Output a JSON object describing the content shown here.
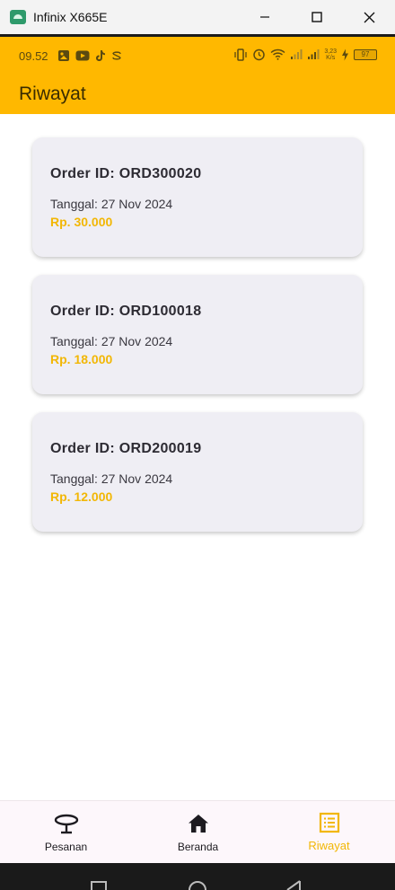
{
  "window": {
    "title": "Infinix X665E",
    "controls": [
      "minimize-icon",
      "maximize-icon",
      "close-icon"
    ]
  },
  "status_bar": {
    "time": "09.52",
    "network_speed_value": "3,23",
    "network_speed_unit": "K/s",
    "battery": "97",
    "icons_left": [
      "gallery-icon",
      "youtube-icon",
      "tiktok-icon",
      "cloud-sync-icon"
    ],
    "icons_right": [
      "vibrate-icon",
      "alarm-icon",
      "wifi-icon",
      "signal-icon",
      "signal-icon",
      "charging-icon",
      "battery-icon"
    ]
  },
  "app_bar": {
    "title": "Riwayat",
    "color": "#ffb800"
  },
  "orders": [
    {
      "order_id": "Order ID: ORD300020",
      "date": "Tanggal: 27 Nov 2024",
      "total": "Rp. 30.000"
    },
    {
      "order_id": "Order ID: ORD100018",
      "date": "Tanggal: 27 Nov 2024",
      "total": "Rp. 18.000"
    },
    {
      "order_id": "Order ID: ORD200019",
      "date": "Tanggal: 27 Nov 2024",
      "total": "Rp. 12.000"
    }
  ],
  "bottom_nav": {
    "items": [
      {
        "label": "Pesanan",
        "icon": "dining-table-icon",
        "active": false
      },
      {
        "label": "Beranda",
        "icon": "home-icon",
        "active": false
      },
      {
        "label": "Riwayat",
        "icon": "list-icon",
        "active": true
      }
    ],
    "active_color": "#f2b705"
  },
  "system_nav": [
    "recent-apps-icon",
    "home-circle-icon",
    "back-icon"
  ]
}
